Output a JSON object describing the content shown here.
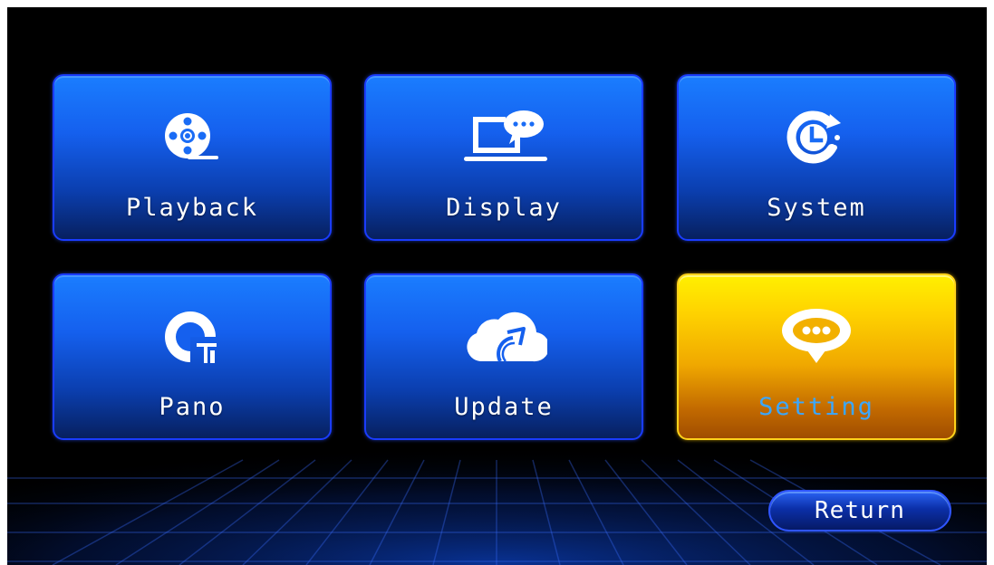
{
  "menu": {
    "tiles": [
      {
        "label": "Playback",
        "icon": "film-reel-icon"
      },
      {
        "label": "Display",
        "icon": "laptop-chat-icon"
      },
      {
        "label": "System",
        "icon": "clock-refresh-icon"
      },
      {
        "label": "Pano",
        "icon": "pano-icon"
      },
      {
        "label": "Update",
        "icon": "cloud-upload-icon"
      },
      {
        "label": "Setting",
        "icon": "speech-bubble-icon"
      }
    ],
    "selected": "Setting"
  },
  "return_label": "Return",
  "colors": {
    "tile_blue": "#1560ee",
    "tile_selected": "#ffd400",
    "selected_label": "#3aa7ff",
    "background": "#000000"
  }
}
